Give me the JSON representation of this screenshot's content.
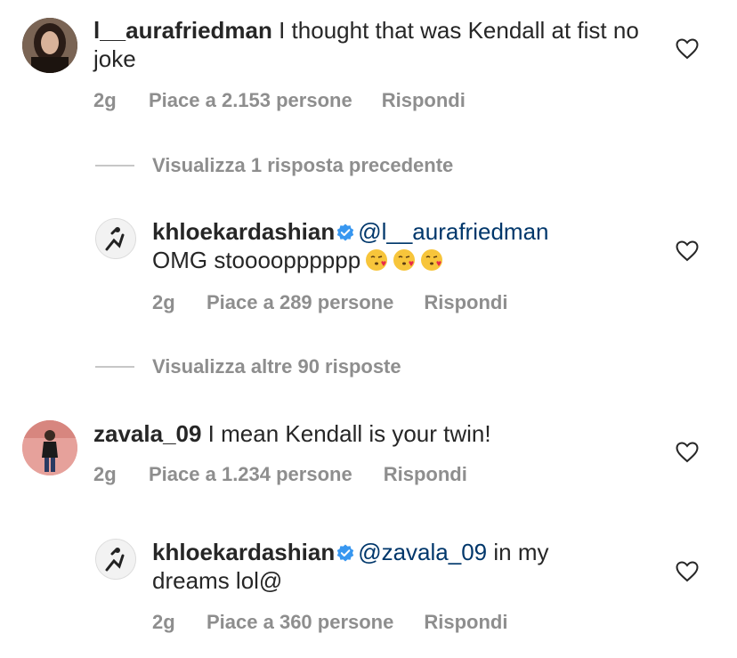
{
  "comments": [
    {
      "username": "l__aurafriedman",
      "text": " I thought that was Kendall at fist no joke",
      "time": "2g",
      "likes": "Piace a 2.153 persone",
      "reply": "Rispondi"
    },
    {
      "username": "khloekardashian",
      "mention": "@l__aurafriedman",
      "text": "OMG stoooopppppp",
      "time": "2g",
      "likes": "Piace a 289 persone",
      "reply": "Rispondi"
    },
    {
      "username": "zavala_09",
      "text": " I mean Kendall is your twin!",
      "time": "2g",
      "likes": "Piace a 1.234 persone",
      "reply": "Rispondi"
    },
    {
      "username": "khloekardashian",
      "mention": "@zavala_09",
      "text_after": " in my",
      "text_line2": "dreams lol@",
      "time": "2g",
      "likes": "Piace a 360 persone",
      "reply": "Rispondi"
    }
  ],
  "threads": [
    {
      "label": "Visualizza 1 risposta precedente"
    },
    {
      "label": "Visualizza altre 90 risposte"
    }
  ],
  "icons": {
    "like": "heart-outline-icon",
    "verified": "verified-badge-icon",
    "emoji": "kissing-face-emoji"
  },
  "colors": {
    "text": "#262626",
    "meta": "#8e8e8e",
    "mention": "#00376b",
    "verified": "#3897f0"
  }
}
